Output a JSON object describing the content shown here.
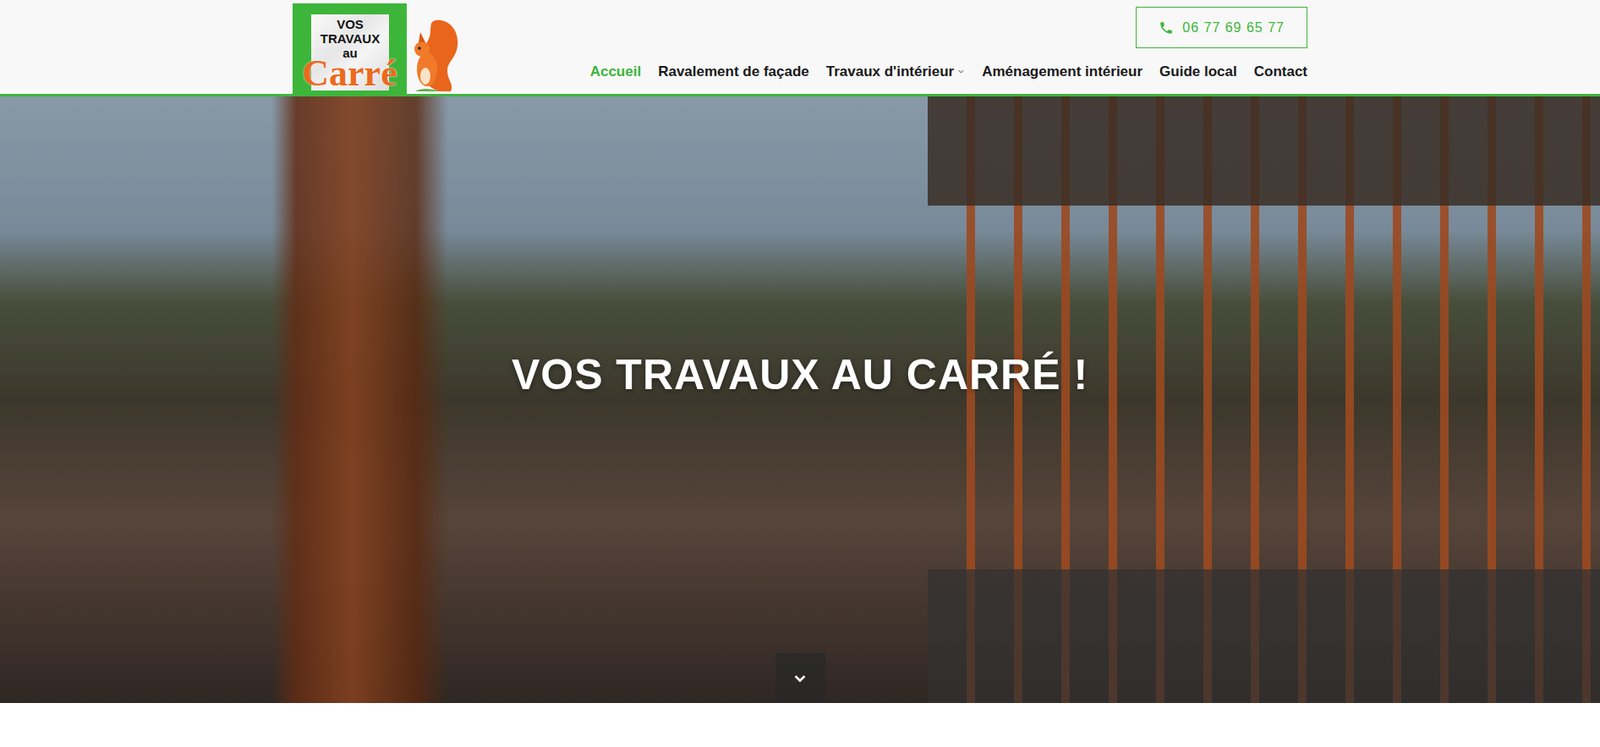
{
  "logo": {
    "lines": [
      "VOS",
      "TRAVAUX",
      "au"
    ],
    "big": "Carré"
  },
  "phone": "06 77 69 65 77",
  "nav": [
    {
      "label": "Accueil",
      "selected": true,
      "dropdown": false
    },
    {
      "label": "Ravalement de façade",
      "selected": false,
      "dropdown": false
    },
    {
      "label": "Travaux d'intérieur",
      "selected": false,
      "dropdown": true
    },
    {
      "label": "Aménagement intérieur",
      "selected": false,
      "dropdown": false
    },
    {
      "label": "Guide local",
      "selected": false,
      "dropdown": false
    },
    {
      "label": "Contact",
      "selected": false,
      "dropdown": false
    }
  ],
  "hero": {
    "title": "VOS TRAVAUX AU CARRÉ !"
  }
}
